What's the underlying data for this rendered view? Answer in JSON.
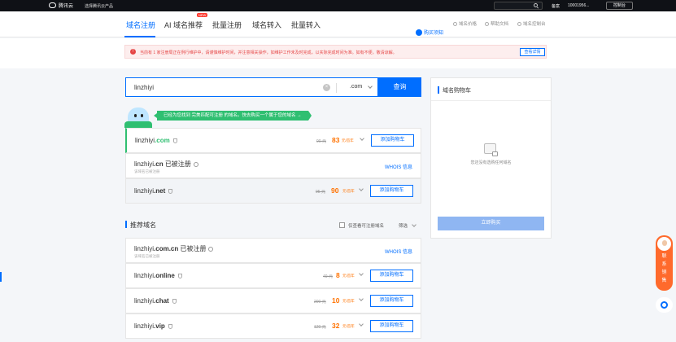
{
  "topbar": {
    "brand": "腾讯云",
    "product_menu": "选择腾讯云产品",
    "links": [
      "备案",
      "10001956...",
      "控制台"
    ]
  },
  "tabs": [
    {
      "label": "域名注册",
      "active": true
    },
    {
      "label": "AI 域名推荐",
      "badge": "NEW"
    },
    {
      "label": "批量注册"
    },
    {
      "label": "域名转入"
    },
    {
      "label": "批量转入"
    }
  ],
  "right_links": {
    "buy_notice": "购买须知",
    "links": [
      "域名价格",
      "帮助文档",
      "域名控制台"
    ]
  },
  "alert": {
    "text": "当前有 1 家注册局正在例行维护中，请谨慎维护时间，并注意相关操作，如维护工作未及时完成，以实际完成时间为准。如有不便，敬请谅解。",
    "button": "查看详情"
  },
  "search": {
    "value": "linzhiyi",
    "suffix": ".com",
    "button": "查询"
  },
  "tip": "已经为您找到 完美匹配可注册 的域名。快去购买一个属于您的域名 →",
  "results": [
    {
      "prefix": "linzhiyi",
      "suffix": ".com",
      "old": "90 元",
      "price": "83",
      "unit": "元/首年",
      "action": "添加购物车"
    },
    {
      "prefix": "linzhiyi",
      "suffix": ".cn",
      "status": "已被注册",
      "note": "该域名已被注册",
      "action": "WHOIS 信息"
    },
    {
      "prefix": "linzhiyi",
      "suffix": ".net",
      "old": "95 元",
      "price": "90",
      "unit": "元/首年",
      "action": "添加购物车"
    }
  ],
  "recommend": {
    "title": "推荐域名",
    "checkbox_label": "仅查看可注册域名",
    "filter": "筛选",
    "items": [
      {
        "prefix": "linzhiyi",
        "suffix": ".com.cn",
        "status": "已被注册",
        "note": "该域名已被注册",
        "action": "WHOIS 信息"
      },
      {
        "prefix": "linzhiyi",
        "suffix": ".online",
        "old": "49 元",
        "price": "8",
        "unit": "元/首年",
        "action": "添加购物车"
      },
      {
        "prefix": "linzhiyi",
        "suffix": ".chat",
        "old": "200 元",
        "price": "10",
        "unit": "元/首年",
        "action": "添加购物车"
      },
      {
        "prefix": "linzhiyi",
        "suffix": ".vip",
        "old": "120 元",
        "price": "32",
        "unit": "元/首年",
        "action": "添加购物车"
      }
    ]
  },
  "cart": {
    "title": "域名购物车",
    "empty": "您还没有选购任何域名",
    "button": "立即购买"
  },
  "float": {
    "label": [
      "联",
      "系",
      "销",
      "售"
    ]
  },
  "colors": {
    "primary": "#006eff",
    "price": "#ff7200",
    "success": "#2fbf71",
    "alert": "#e54545"
  }
}
